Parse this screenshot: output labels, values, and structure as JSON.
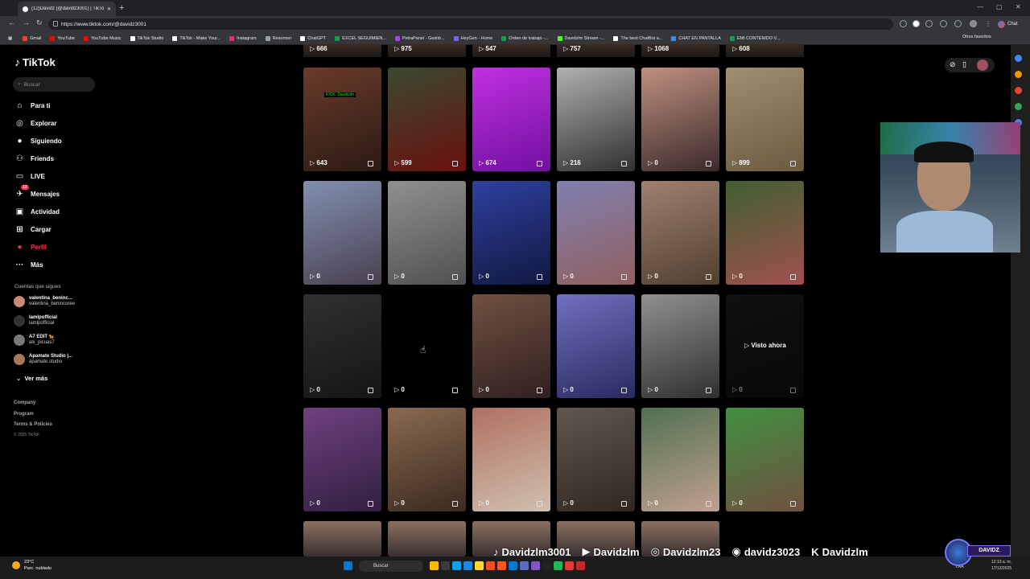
{
  "browser": {
    "tab_title": "(12)Davidz (@davidz3001) | TikTok",
    "new_tab": "+",
    "url": "https://www.tiktok.com/@davidz3001",
    "chat_label": "Chat",
    "bookmarks": [
      {
        "label": "Gmail",
        "color": "#ea4335"
      },
      {
        "label": "YouTube",
        "color": "#ff0000"
      },
      {
        "label": "YouTube Music",
        "color": "#ff0000"
      },
      {
        "label": "TikTok Studio",
        "color": "#ffffff"
      },
      {
        "label": "TikTok - Make Your...",
        "color": "#ffffff"
      },
      {
        "label": "Instagram",
        "color": "#e1306c"
      },
      {
        "label": "Resumen",
        "color": "#9aa0a6"
      },
      {
        "label": "ChatGPT",
        "color": "#ffffff"
      },
      {
        "label": "EXCEL SEGUIMIEN...",
        "color": "#0f9d58"
      },
      {
        "label": "PetraPanel - Gestió...",
        "color": "#a142f4"
      },
      {
        "label": "HeyGen - Home",
        "color": "#7b61ff"
      },
      {
        "label": "Orden de trabajo -...",
        "color": "#0f9d58"
      },
      {
        "label": "Davidzlm Stream -...",
        "color": "#53fc18"
      },
      {
        "label": "The best ChatBot a...",
        "color": "#ffffff"
      },
      {
        "label": "CHAT EN PANTALLA",
        "color": "#4285f4"
      },
      {
        "label": "EMI CONTENIDO V...",
        "color": "#0f9d58"
      }
    ],
    "otros": "Otros favoritos"
  },
  "sidebar": {
    "logo": "TikTok",
    "search_placeholder": "Buscar",
    "nav": [
      {
        "label": "Para ti",
        "icon": "home-icon",
        "glyph": "⌂"
      },
      {
        "label": "Explorar",
        "icon": "compass-icon",
        "glyph": "◎"
      },
      {
        "label": "Siguiendo",
        "icon": "following-icon",
        "glyph": "●"
      },
      {
        "label": "Friends",
        "icon": "friends-icon",
        "glyph": "⚇"
      },
      {
        "label": "LIVE",
        "icon": "live-icon",
        "glyph": "▭"
      },
      {
        "label": "Mensajes",
        "icon": "messages-icon",
        "glyph": "✈"
      },
      {
        "label": "Actividad",
        "icon": "activity-icon",
        "glyph": "▣"
      },
      {
        "label": "Cargar",
        "icon": "upload-icon",
        "glyph": "⊞"
      },
      {
        "label": "Perfil",
        "icon": "profile-icon",
        "glyph": "●"
      },
      {
        "label": "Más",
        "icon": "more-icon",
        "glyph": "···"
      }
    ],
    "messages_badge": "12",
    "following_title": "Cuentas que sigues",
    "accounts": [
      {
        "name": "valentina_beninc...",
        "handle": "valentina_benincoree",
        "color": "#cc8877"
      },
      {
        "name": "lamlpofficial",
        "handle": "lamlpofficial",
        "color": "#333333"
      },
      {
        "name": "A7 EDIT 🐆",
        "handle": "alx_picuas7",
        "color": "#777777"
      },
      {
        "name": "Apamate Studio |...",
        "handle": "apamate.studio",
        "color": "#aa7755"
      }
    ],
    "ver_mas": "Ver más",
    "footer": [
      "Company",
      "Program",
      "Terms & Policies"
    ],
    "copyright": "© 2025 TikTok"
  },
  "grid": {
    "top_row_counts": [
      "666",
      "975",
      "547",
      "757",
      "1068",
      "608"
    ],
    "rows": [
      {
        "tiles": [
          {
            "count": "643",
            "c1": "#6a3b2a",
            "c2": "#2a1a14"
          },
          {
            "count": "599",
            "c1": "#3a4a30",
            "c2": "#6a1010"
          },
          {
            "count": "674",
            "c1": "#c030e0",
            "c2": "#7010a0"
          },
          {
            "count": "216",
            "c1": "#b0b0b0",
            "c2": "#303030"
          },
          {
            "count": "0",
            "c1": "#c09080",
            "c2": "#3a2a2a"
          },
          {
            "count": "899",
            "c1": "#a09070",
            "c2": "#6a5a40"
          }
        ]
      },
      {
        "tiles": [
          {
            "count": "0",
            "c1": "#8090b0",
            "c2": "#4a4050"
          },
          {
            "count": "0",
            "c1": "#909090",
            "c2": "#505050"
          },
          {
            "count": "0",
            "c1": "#3040a0",
            "c2": "#101840"
          },
          {
            "count": "0",
            "c1": "#8080b0",
            "c2": "#906060"
          },
          {
            "count": "0",
            "c1": "#a08070",
            "c2": "#504030"
          },
          {
            "count": "0",
            "c1": "#406030",
            "c2": "#a05050"
          }
        ]
      },
      {
        "tiles": [
          {
            "count": "0",
            "c1": "#303030",
            "c2": "#151515"
          },
          {
            "count": "0",
            "c1": "#000000",
            "c2": "#000000"
          },
          {
            "count": "0",
            "c1": "#705040",
            "c2": "#302020"
          },
          {
            "count": "0",
            "c1": "#7070c0",
            "c2": "#2a2a60"
          },
          {
            "count": "0",
            "c1": "#909090",
            "c2": "#303030"
          },
          {
            "count": "0",
            "c1": "#202020",
            "c2": "#101010"
          }
        ]
      },
      {
        "tiles": [
          {
            "count": "0",
            "c1": "#704080",
            "c2": "#302040"
          },
          {
            "count": "0",
            "c1": "#8a6a50",
            "c2": "#3a2a20"
          },
          {
            "count": "0",
            "c1": "#b07060",
            "c2": "#d0c0b0"
          },
          {
            "count": "0",
            "c1": "#605850",
            "c2": "#302820"
          },
          {
            "count": "0",
            "c1": "#507050",
            "c2": "#c0a090"
          },
          {
            "count": "0",
            "c1": "#409040",
            "c2": "#705040"
          }
        ]
      }
    ],
    "visto_ahora": "Visto ahora",
    "kick_tag": "KICK: Davidzlm"
  },
  "overlay": {
    "social": [
      {
        "icon": "tiktok-icon",
        "glyph": "♪",
        "label": "Davidzlm3001"
      },
      {
        "icon": "youtube-icon",
        "glyph": "▶",
        "label": "Davidzlm"
      },
      {
        "icon": "instagram-icon",
        "glyph": "◎",
        "label": "Davidzlm23"
      },
      {
        "icon": "discord-icon",
        "glyph": "◉",
        "label": "davidz3023"
      },
      {
        "icon": "kick-icon",
        "glyph": "K",
        "label": "Davidzlm"
      }
    ],
    "badge": "DAVIDZ"
  },
  "taskbar": {
    "temp": "23°C",
    "weather": "Parc. nublado",
    "search": "Buscar",
    "lang": "LAA",
    "time": "12:13 a. m.",
    "date": "17/12/2025"
  }
}
